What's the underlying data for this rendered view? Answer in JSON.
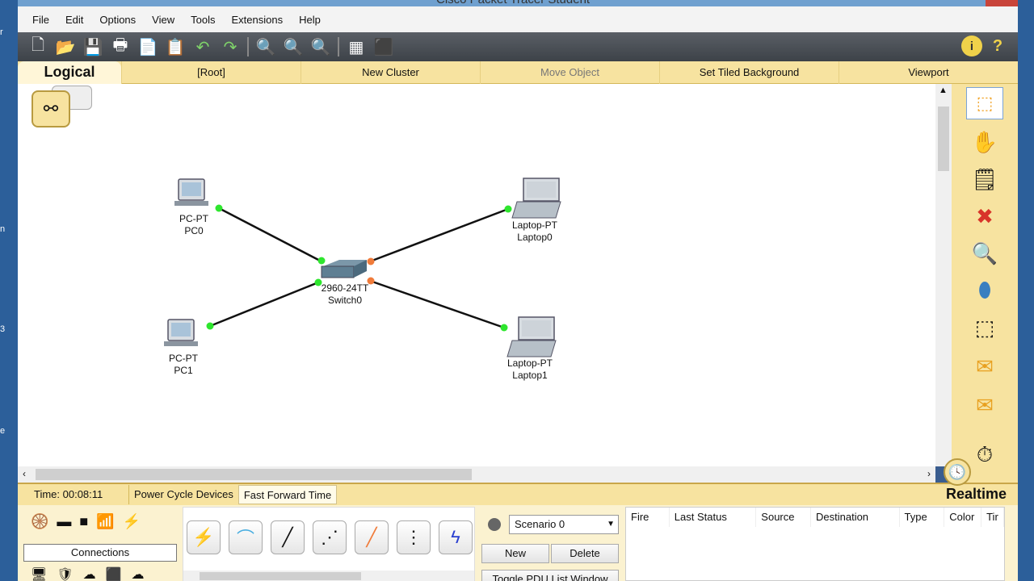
{
  "window": {
    "title": "Cisco Packet Tracer Student"
  },
  "menu": [
    "File",
    "Edit",
    "Options",
    "View",
    "Tools",
    "Extensions",
    "Help"
  ],
  "toolbar": {
    "icons": [
      "new-icon",
      "open-icon",
      "save-icon",
      "print-icon",
      "activity-wizard-icon",
      "copy-icon",
      "undo-icon",
      "redo-icon",
      "zoom-in-icon",
      "zoom-reset-icon",
      "zoom-out-icon",
      "palette-icon",
      "custom-device-icon"
    ],
    "help_info": "i",
    "help_q": "?"
  },
  "navbar": {
    "logical": "Logical",
    "root": "[Root]",
    "new_cluster": "New Cluster",
    "move_object": "Move Object",
    "set_tiled_bg": "Set Tiled Background",
    "viewport": "Viewport"
  },
  "devices": [
    {
      "id": "pc0",
      "type": "PC-PT",
      "name": "PC0"
    },
    {
      "id": "pc1",
      "type": "PC-PT",
      "name": "PC1"
    },
    {
      "id": "switch0",
      "type": "2960-24TT",
      "name": "Switch0"
    },
    {
      "id": "laptop0",
      "type": "Laptop-PT",
      "name": "Laptop0"
    },
    {
      "id": "laptop1",
      "type": "Laptop-PT",
      "name": "Laptop1"
    }
  ],
  "link_colors": {
    "up": "#2ee62e",
    "down": "#f07b3a",
    "cable": "#111111"
  },
  "status": {
    "time": "Time: 00:08:11",
    "power_cycle": "Power Cycle Devices",
    "fast_forward": "Fast Forward Time",
    "mode": "Realtime"
  },
  "bottom": {
    "connections_label": "Connections",
    "scenario": "Scenario 0",
    "new": "New",
    "delete": "Delete",
    "toggle_pdu": "Toggle PDU List Window",
    "pdu_columns": [
      "Fire",
      "Last Status",
      "Source",
      "Destination",
      "Type",
      "Color",
      "Tir"
    ]
  },
  "colors": {
    "accent_yellow": "#f7e3a0",
    "toolbar_dark": "#4a4f55"
  }
}
